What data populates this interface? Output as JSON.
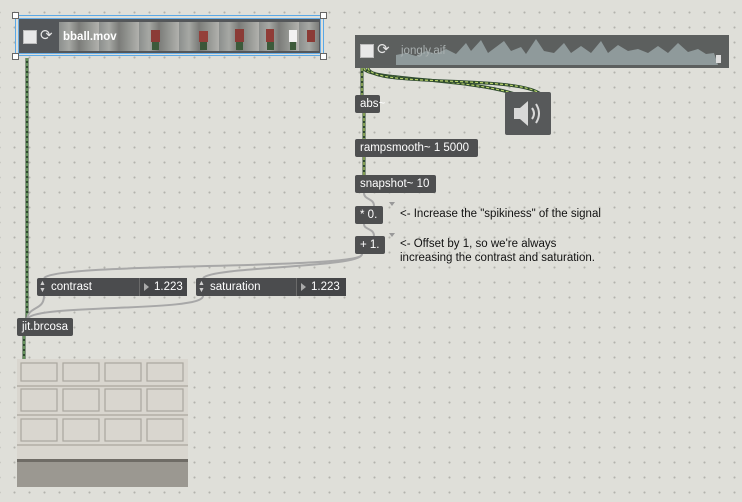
{
  "movie_player": {
    "filename": "bball.mov"
  },
  "audio_player": {
    "filename": "jongly.aif"
  },
  "objects": {
    "abs": "abs~",
    "rampsmooth": "rampsmooth~ 1 5000",
    "snapshot": "snapshot~ 10",
    "multiply": "* 0.",
    "add": "+ 1.",
    "brcosa": "jit.brcosa"
  },
  "attributes": {
    "contrast": {
      "label": "contrast",
      "value": "1.223"
    },
    "saturation": {
      "label": "saturation",
      "value": "1.223"
    }
  },
  "comments": {
    "spikiness": "<- Increase the \"spikiness\" of the signal",
    "offset_line1": "<- Offset by 1, so we're always",
    "offset_line2": "increasing the contrast and saturation."
  },
  "colors": {
    "background": "#dfdfd9",
    "object_fill": "#4e4f50",
    "selection_outline": "#5aa8e6",
    "signal_cord": "#9dbb4c",
    "patch_cord": "#a8a8a8"
  },
  "icons": {
    "speaker": "speaker-icon",
    "loop": "loop-icon",
    "play_toggle": "play-toggle-icon"
  }
}
